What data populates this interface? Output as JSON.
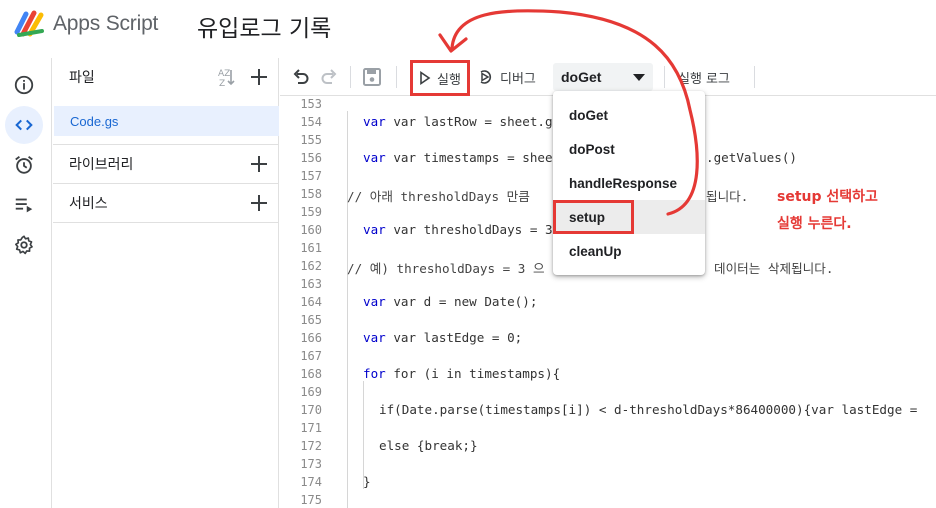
{
  "header": {
    "app_name": "Apps Script",
    "project_title": "유입로그 기록"
  },
  "rail": {
    "items": [
      {
        "icon": "info-icon",
        "active": false
      },
      {
        "icon": "code-icon",
        "active": true
      },
      {
        "icon": "alarm-clock-icon",
        "active": false
      },
      {
        "icon": "executions-icon",
        "active": false
      },
      {
        "icon": "gear-icon",
        "active": false
      }
    ]
  },
  "files_panel": {
    "files_label": "파일",
    "sort_label": "AZ",
    "file": "Code.gs",
    "libraries_label": "라이브러리",
    "services_label": "서비스"
  },
  "toolbar": {
    "run_label": "실행",
    "debug_label": "디버그",
    "function_selected": "doGet",
    "log_label": "실행 로그"
  },
  "dropdown": {
    "options": [
      "doGet",
      "doPost",
      "handleResponse",
      "setup",
      "cleanUp"
    ]
  },
  "annotation": {
    "line1": "setup 선택하고",
    "line2": "실행 누른다."
  },
  "editor": {
    "line_numbers": [
      "153",
      "154",
      "155",
      "156",
      "157",
      "158",
      "159",
      "160",
      "161",
      "162",
      "163",
      "164",
      "165",
      "166",
      "167",
      "168",
      "169",
      "170",
      "171",
      "172",
      "173",
      "174",
      "175"
    ],
    "lines": {
      "l154": "var lastRow = sheet.getLa",
      "l156a": "var timestamps = sheet.ge",
      "l156b": ".getValues()",
      "l158a": "// 아래 thresholdDays 만큼 ",
      "l158b": "됩니다.",
      "l160": "var thresholdDays = 3",
      "l162a": "// 예) thresholdDays = 3 으",
      "l162b": "데이터는 삭제됩니다.",
      "l164": "var d = new Date();",
      "l166": "var lastEdge = 0;",
      "l168": "for (i in timestamps){",
      "l170": "if(Date.parse(timestamps[i]) < d-thresholdDays*86400000){var lastEdge =",
      "l172": "else {break;}",
      "l174": "}"
    }
  },
  "colors": {
    "accent_blue": "#1967d2",
    "annotation_red": "#e53935"
  }
}
